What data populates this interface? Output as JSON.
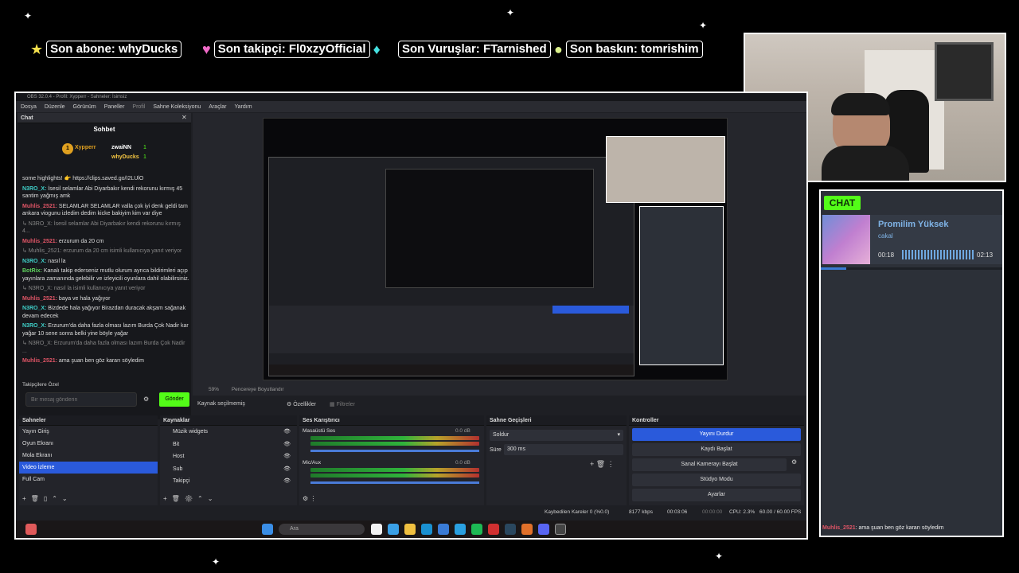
{
  "overlay": {
    "last_sub": "Son abone: whyDucks",
    "last_follower": "Son takipçi: Fl0xzyOfficial",
    "last_hits": "Son Vuruşlar: FTarnished",
    "last_raid": "Son baskın: tomrishim"
  },
  "obs": {
    "window_title": "OBS 32.0.4 - Profil: Xypperr - Sahneler: İsimsiz",
    "menu": [
      "Dosya",
      "Düzenle",
      "Görünüm",
      "Paneller",
      "Profil",
      "Sahne Koleksiyonu",
      "Araçlar",
      "Yardım"
    ],
    "chat_dock": {
      "title": "Chat",
      "header": "Sohbet",
      "top_users": [
        {
          "rank": "1",
          "name": "Xypperr"
        },
        {
          "name": "zwaiNN",
          "count": "1"
        },
        {
          "name": "whyDucks",
          "count": "1"
        }
      ],
      "messages": [
        {
          "user": "",
          "text": "some highlights! 👉 https://clips.saved.go/I2LUlO",
          "style": "plain"
        },
        {
          "user": "N3RO_X:",
          "text": "İsesil selamlar Abi Diyarbakır kendi rekorunu kırmış 45 santim yağmış amk",
          "style": "u2"
        },
        {
          "user": "Muhlis_2521:",
          "text": "SELAMLAR SELAMLAR valla çok iyi denk geldi tam ankara viogunu izledim dedim kicke bakiyim kim var diye",
          "style": "u1"
        },
        {
          "user": "",
          "text": "↳ N3RO_X: İsesil selamlar Abi Diyarbakır kendi rekorunu kırmış 4...",
          "style": "dim"
        },
        {
          "user": "Muhlis_2521:",
          "text": "erzurum da 20 cm",
          "style": "u1"
        },
        {
          "user": "",
          "text": "↳ Muhlis_2521: erzurum da 20 cm isimli kullanıcıya yanıt veriyor",
          "style": "dim"
        },
        {
          "user": "N3RO_X:",
          "text": "nasıl la",
          "style": "u2"
        },
        {
          "user": "BotRix:",
          "text": "Kanalı takip ederseniz mutlu olurum ayrıca bildirimleri açıp yayınlara zamanında gelebilir ve izleyicili oyunlara dahil olabilirsiniz.",
          "style": "u3"
        },
        {
          "user": "",
          "text": "↳ N3RO_X: nasıl la isimli kullanıcıya yanıt veriyor",
          "style": "dim"
        },
        {
          "user": "Muhlis_2521:",
          "text": "baya ve hala yağıyor",
          "style": "u1"
        },
        {
          "user": "N3RO_X:",
          "text": "Bizdede hala yağıyor Birazdan duracak akşam sağanak devam edecek",
          "style": "u2"
        },
        {
          "user": "N3RO_X:",
          "text": "Erzurum'da daha fazla olması lazım Burda Çok Nadir kar yağar 10 sene sonra belki yine böyle yağar",
          "style": "u2"
        },
        {
          "user": "",
          "text": "↳ N3RO_X: Erzurum'da daha fazla olması lazım Burda Çok Nadir ...",
          "style": "dim"
        },
        {
          "user": "Muhlis_2521:",
          "text": "ama şuan ben göz kararı söyledim",
          "style": "u1"
        }
      ],
      "followers_label": "Takipçilere Özel",
      "input_placeholder": "Bir mesaj gönderin",
      "send_label": "Gönder"
    },
    "preview_footer": {
      "zoom": "59%",
      "fit": "Pencereye Boyutlandır"
    },
    "source_toolbar": {
      "no_source": "Kaynak seçilmemiş",
      "properties": "Özellikler",
      "filters": "Filtreler"
    },
    "scenes": {
      "title": "Sahneler",
      "items": [
        "Yayın Giriş",
        "Oyun Ekranı",
        "Mola Ekranı",
        "Video İzleme",
        "Full Cam"
      ],
      "selected": "Video İzleme"
    },
    "sources": {
      "title": "Kaynaklar",
      "items": [
        "Müzik widgets",
        "Bit",
        "Host",
        "Sub",
        "Takipçi"
      ]
    },
    "mixer": {
      "title": "Ses Karıştırıcı",
      "channels": [
        {
          "name": "Masaüstü Ses",
          "db": "0.0 dB"
        },
        {
          "name": "Mic/Aux",
          "db": "0.0 dB"
        }
      ],
      "ticks": [
        "-60",
        "-55",
        "-50",
        "-45",
        "-40",
        "-35",
        "-30",
        "-25",
        "-20",
        "-15",
        "-10",
        "-5",
        "0"
      ]
    },
    "transitions": {
      "title": "Sahne Geçişleri",
      "type": "Soldur",
      "duration_label": "Süre",
      "duration": "300 ms"
    },
    "controls": {
      "title": "Kontroller",
      "buttons": [
        "Yayını Durdur",
        "Kaydı Başlat",
        "Sanal Kamerayı Başlat",
        "Stüdyo Modu",
        "Ayarlar"
      ]
    },
    "status": {
      "dropped": "Kaybedilen Kareler 0 (%0.0)",
      "bitrate": "8177 kbps",
      "stream_time": "00:03:06",
      "rec_time": "00:00:00",
      "cpu": "CPU: 2.3%",
      "fps": "60.00 / 60.00 FPS"
    },
    "taskbar": {
      "search_placeholder": "Ara"
    }
  },
  "chat_widget": {
    "badge": "CHAT",
    "song_title": "Promilim Yüksek",
    "artist": "cakal",
    "time_current": "00:18",
    "time_total": "02:13",
    "progress": 0.14,
    "last_message_user": "Muhlis_2521",
    "last_message_text": ": ama şuan ben göz kararı söyledim"
  },
  "colors": {
    "accent": "#2a5adb",
    "chat_green": "#53fc18",
    "widget_bg": "#2c3038",
    "widget_text": "#7fb3e6"
  }
}
